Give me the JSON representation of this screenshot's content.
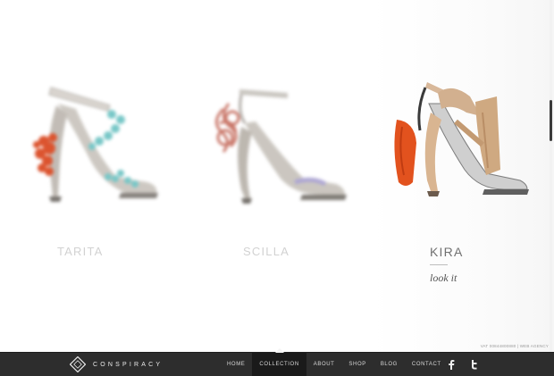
{
  "products": [
    {
      "name": "TARITA"
    },
    {
      "name": "SCILLA"
    },
    {
      "name": "KIRA",
      "cta": "look it"
    }
  ],
  "credits": "VAT 00844800880 | WEB AGENCY",
  "brand": {
    "name": "CONSPIRACY"
  },
  "nav": {
    "items": [
      {
        "label": "HOME"
      },
      {
        "label": "COLLECTION"
      },
      {
        "label": "ABOUT"
      },
      {
        "label": "SHOP"
      },
      {
        "label": "BLOG"
      },
      {
        "label": "CONTACT"
      }
    ],
    "active": "COLLECTION"
  },
  "social": {
    "icons": [
      "facebook-icon",
      "twitter-icon"
    ]
  },
  "colors": {
    "footer_bg": "#2d2d2d",
    "nav_active_bg": "#1a1a1a",
    "text_faded": "#d2d2d2",
    "text_active": "#707070"
  }
}
